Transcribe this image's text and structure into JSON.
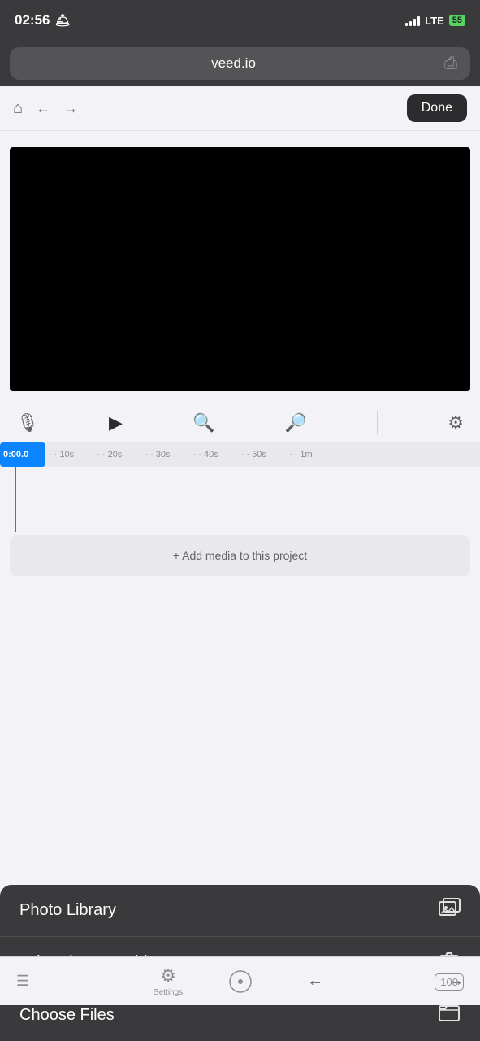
{
  "statusBar": {
    "time": "02:56",
    "lte": "LTE",
    "battery": "55"
  },
  "browserChrome": {
    "url": "veed.io"
  },
  "navBar": {
    "doneLabel": "Done"
  },
  "timeline": {
    "currentTime": "0:00.0",
    "ticks": [
      "10s",
      "20s",
      "30s",
      "40s",
      "50s",
      "1m"
    ]
  },
  "addMedia": {
    "label": "+ Add media to this project"
  },
  "actionSheet": {
    "items": [
      {
        "label": "Photo Library",
        "icon": "🖼"
      },
      {
        "label": "Take Photo or Video",
        "icon": "📷"
      },
      {
        "label": "Choose Files",
        "icon": "🗂"
      }
    ]
  },
  "bottomToolbar": {
    "settingsLabel": "Settings"
  }
}
